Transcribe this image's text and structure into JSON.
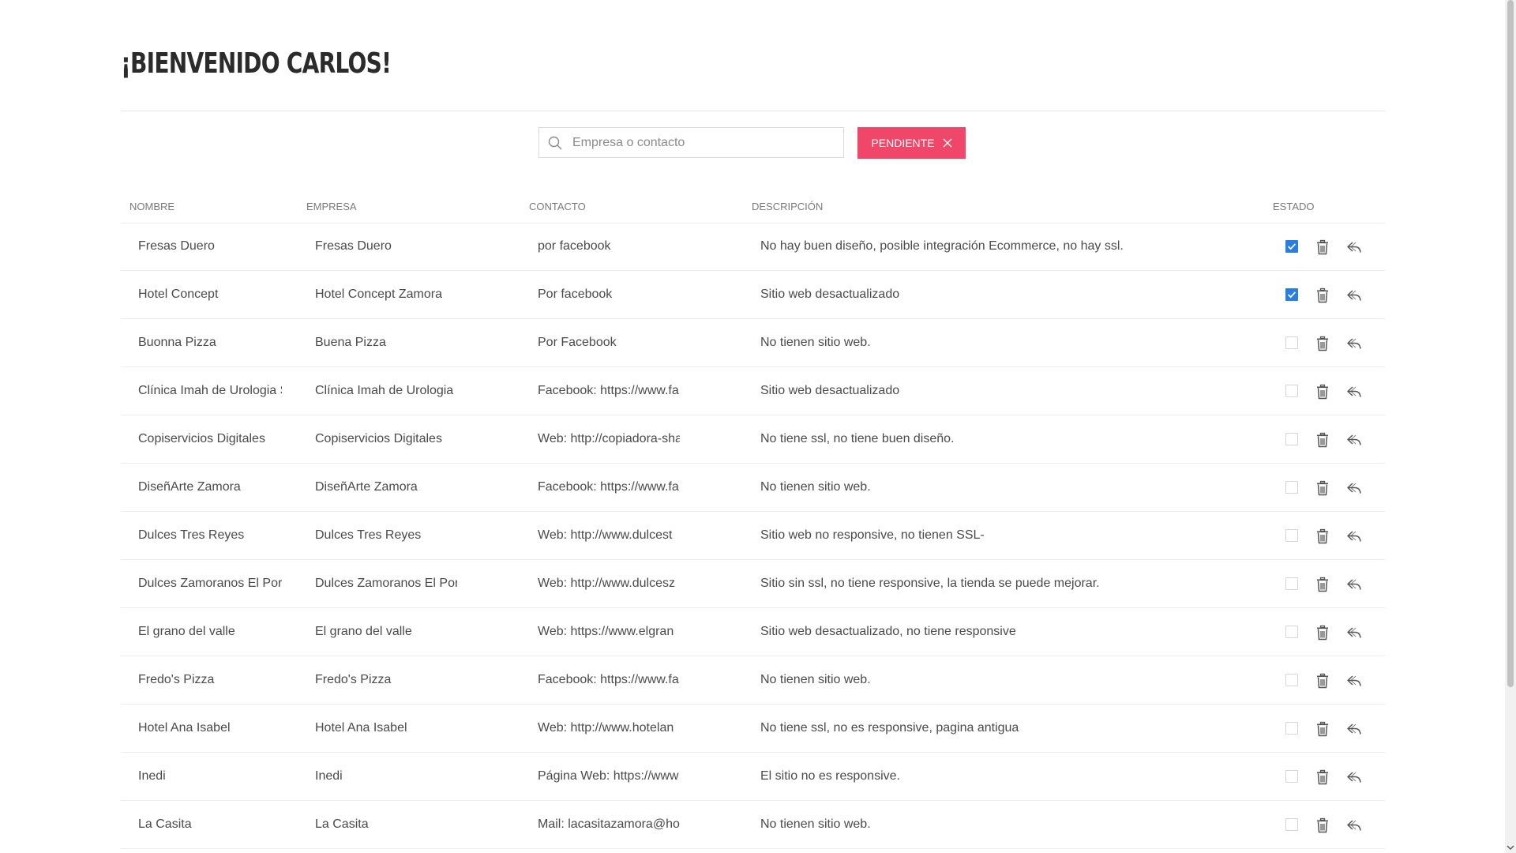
{
  "header": {
    "title": "¡Bienvenido Carlos!"
  },
  "search": {
    "placeholder": "Empresa o contacto",
    "value": ""
  },
  "filter": {
    "label": "PENDIENTE"
  },
  "table": {
    "columns": {
      "nombre": "NOMBRE",
      "empresa": "EMPRESA",
      "contacto": "CONTACTO",
      "descripcion": "DESCRIPCIÓN",
      "estado": "ESTADO"
    },
    "rows": [
      {
        "nombre": "Fresas Duero",
        "empresa": "Fresas Duero",
        "contacto": "por facebook",
        "descripcion": "No hay buen diseño, posible integración Ecommerce, no hay ssl.",
        "estado": true
      },
      {
        "nombre": "Hotel Concept",
        "empresa": "Hotel Concept Zamora",
        "contacto": "Por facebook",
        "descripcion": "Sitio web desactualizado",
        "estado": true
      },
      {
        "nombre": "Buonna Pizza",
        "empresa": "Buena Pizza",
        "contacto": "Por Facebook",
        "descripcion": "No tienen sitio web.",
        "estado": false
      },
      {
        "nombre": "Clínica Imah de Urologia S",
        "empresa": "Clínica Imah de Urologia S",
        "contacto": "Facebook: https://www.fa",
        "descripcion": "Sitio web desactualizado",
        "estado": false
      },
      {
        "nombre": "Copiservicios Digitales",
        "empresa": "Copiservicios Digitales",
        "contacto": "Web: http://copiadora-sha",
        "descripcion": "No tiene ssl, no tiene buen diseño.",
        "estado": false
      },
      {
        "nombre": "DiseñArte Zamora",
        "empresa": "DiseñArte Zamora",
        "contacto": "Facebook: https://www.fa",
        "descripcion": "No tienen sitio web.",
        "estado": false
      },
      {
        "nombre": "Dulces Tres Reyes",
        "empresa": "Dulces Tres Reyes",
        "contacto": "Web: http://www.dulcest",
        "descripcion": "Sitio web no responsive, no tienen SSL-",
        "estado": false
      },
      {
        "nombre": "Dulces Zamoranos El Port",
        "empresa": "Dulces Zamoranos El Port",
        "contacto": "Web: http://www.dulcesz",
        "descripcion": "Sitio sin ssl, no tiene responsive, la tienda se puede mejorar.",
        "estado": false
      },
      {
        "nombre": "El grano del valle",
        "empresa": "El grano del valle",
        "contacto": "Web: https://www.elgran",
        "descripcion": "Sitio web desactualizado, no tiene responsive",
        "estado": false
      },
      {
        "nombre": "Fredo's Pizza",
        "empresa": "Fredo's Pizza",
        "contacto": "Facebook: https://www.fa",
        "descripcion": "No tienen sitio web.",
        "estado": false
      },
      {
        "nombre": "Hotel Ana Isabel",
        "empresa": "Hotel Ana Isabel",
        "contacto": "Web: http://www.hotelan",
        "descripcion": "No tiene ssl, no es responsive, pagina antigua",
        "estado": false
      },
      {
        "nombre": "Inedi",
        "empresa": "Inedi",
        "contacto": "Página Web: https://www",
        "descripcion": "El sitio no es responsive.",
        "estado": false
      },
      {
        "nombre": "La Casita",
        "empresa": "La Casita",
        "contacto": "Mail:  lacasitazamora@ho",
        "descripcion": "No tienen sitio web.",
        "estado": false
      }
    ]
  },
  "icons": {
    "search": "search-icon",
    "close": "close-icon",
    "trash": "trash-icon",
    "reply": "reply-icon",
    "check": "check-icon"
  },
  "colors": {
    "accent": "#f0466a",
    "checkbox_checked": "#2a7ee0",
    "text": "#4a4a4a",
    "header_text": "#7a7a7a"
  }
}
